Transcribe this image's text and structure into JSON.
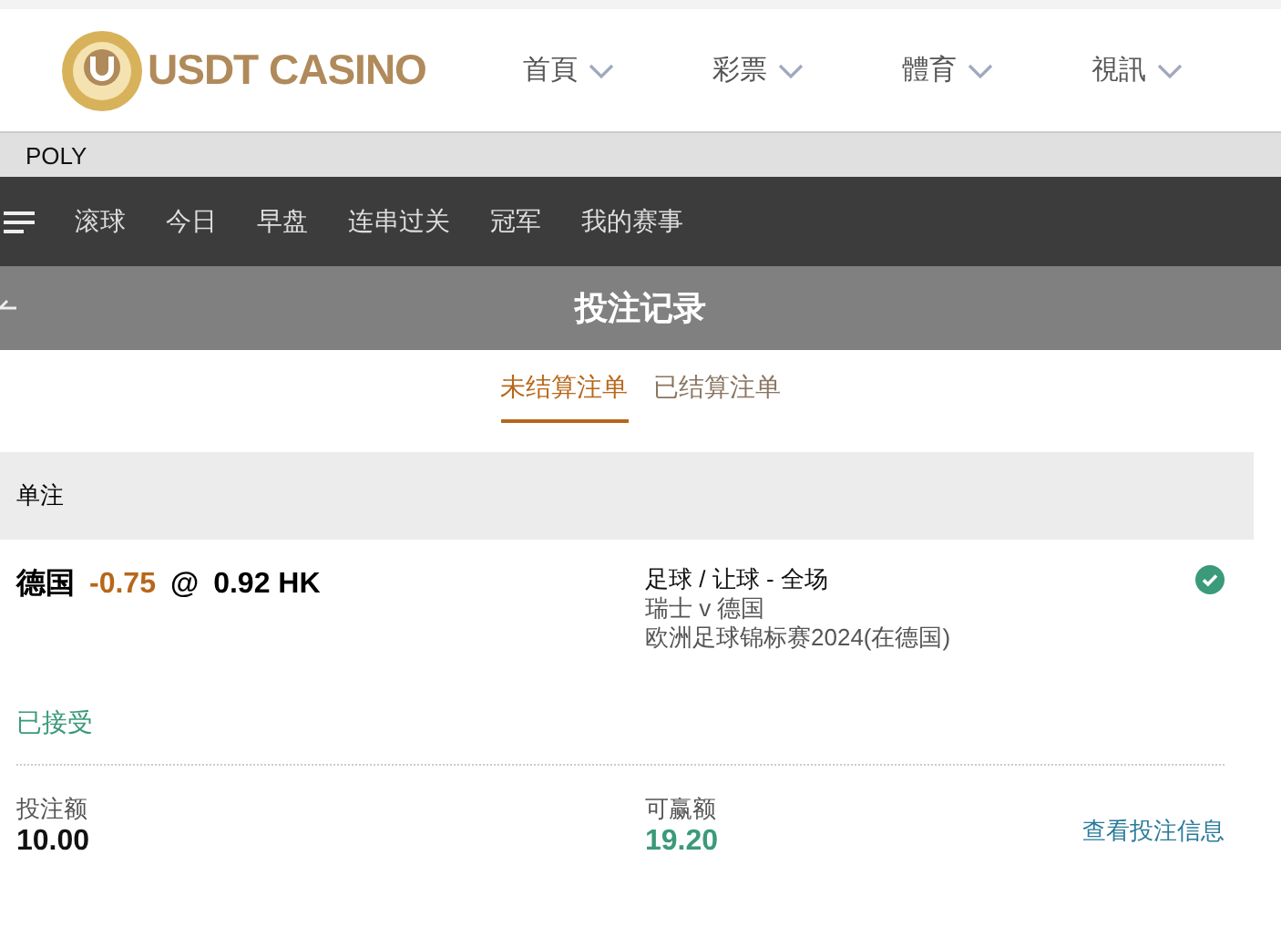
{
  "header": {
    "brand": "USDT CASINO",
    "menu": [
      {
        "label": "首頁"
      },
      {
        "label": "彩票"
      },
      {
        "label": "體育"
      },
      {
        "label": "視訊"
      }
    ]
  },
  "provider_bar": {
    "label": "POLY"
  },
  "sport_nav": {
    "items": [
      {
        "label": "滚球"
      },
      {
        "label": "今日"
      },
      {
        "label": "早盘"
      },
      {
        "label": "连串过关"
      },
      {
        "label": "冠军"
      },
      {
        "label": "我的赛事"
      }
    ]
  },
  "title_bar": {
    "title": "投注记录"
  },
  "tabs": [
    {
      "label": "未结算注单",
      "selected": true
    },
    {
      "label": "已结算注单",
      "selected": false
    }
  ],
  "section": {
    "title": "单注"
  },
  "bet": {
    "selection": "德国",
    "handicap": "-0.75",
    "at": "@",
    "odds": "0.92 HK",
    "market": "足球 / 让球 - 全场",
    "match": "瑞士 v 德国",
    "league": "欧洲足球锦标赛2024(在德国)",
    "confirmed": true,
    "status": "已接受",
    "stake_label": "投注额",
    "stake": "10.00",
    "win_label": "可赢额",
    "win": "19.20",
    "details_link": "查看投注信息"
  }
}
